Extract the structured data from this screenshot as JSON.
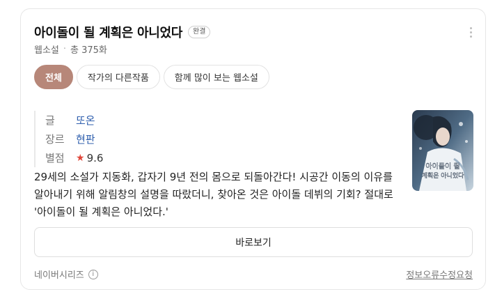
{
  "header": {
    "title": "아이돌이 될 계획은 아니었다",
    "status_badge": "완결",
    "category": "웹소설",
    "episodes": "총 375화"
  },
  "tabs": [
    {
      "label": "전체",
      "active": true
    },
    {
      "label": "작가의 다른작품",
      "active": false
    },
    {
      "label": "함께 많이 보는 웹소설",
      "active": false
    }
  ],
  "info": {
    "author_label": "글",
    "author": "또온",
    "genre_label": "장르",
    "genre": "현판",
    "rating_label": "별점",
    "rating": "9.6"
  },
  "cover": {
    "overlay_text_line1": "아이돌이 될",
    "overlay_text_line2": "계획은 아니었다"
  },
  "description": "29세의 소설가 지동화, 갑자기 9년 전의 몸으로 되돌아간다! 시공간 이동의 이유를 알아내기 위해 알림창의 설명을 따랐더니, 찾아온 것은 아이돌 데뷔의 기회? 절대로 '아이돌이 될 계획은 아니었다.'",
  "actions": {
    "read_label": "바로보기"
  },
  "footer": {
    "source": "네이버시리즈",
    "report": "정보오류수정요청"
  },
  "colors": {
    "active_tab": "#b78779",
    "link": "#2f5fae",
    "star": "#e0463a"
  }
}
